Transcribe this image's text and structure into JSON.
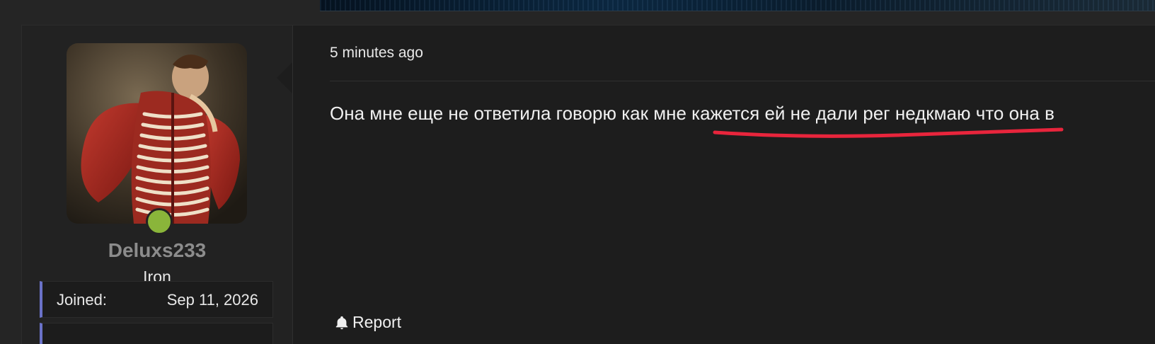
{
  "post": {
    "timestamp": "5 minutes ago",
    "message": "Она мне еще не ответила говорю как мне кажется ей не дали рег недкмаю что она в",
    "report_label": "Report"
  },
  "user": {
    "username": "Deluxs233",
    "rank": "Iron",
    "joined_label": "Joined:",
    "joined_value": "Sep 11, 2026",
    "online": true
  },
  "colors": {
    "online": "#8ab53a",
    "accent_border": "#6a72c8",
    "annotation": "#e8253c"
  },
  "icons": {
    "report": "bell-icon"
  }
}
